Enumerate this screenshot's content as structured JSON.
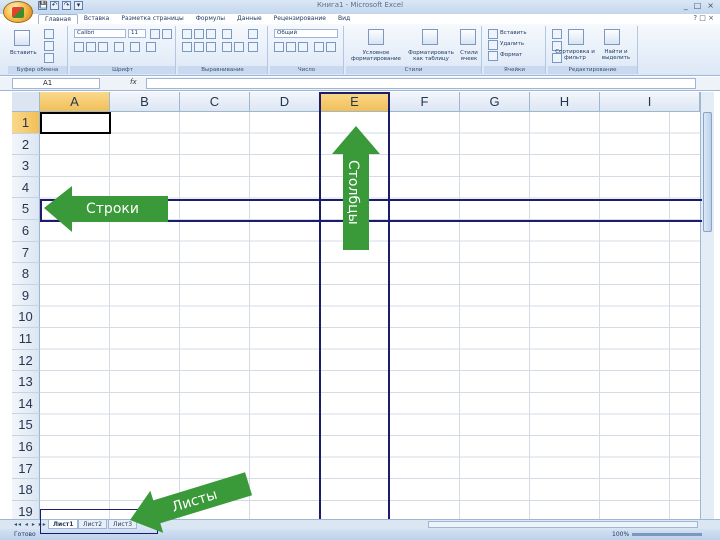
{
  "window": {
    "title": "Книга1 - Microsoft Excel",
    "controls": [
      "_",
      "□",
      "×"
    ]
  },
  "quick_access": [
    "💾",
    "↶",
    "↷",
    "▾"
  ],
  "ribbon": {
    "tabs": [
      {
        "label": "Главная",
        "active": true
      },
      {
        "label": "Вставка",
        "active": false
      },
      {
        "label": "Разметка страницы",
        "active": false
      },
      {
        "label": "Формулы",
        "active": false
      },
      {
        "label": "Данные",
        "active": false
      },
      {
        "label": "Рецензирование",
        "active": false
      },
      {
        "label": "Вид",
        "active": false
      }
    ],
    "groups": {
      "clipboard": {
        "label": "Буфер обмена",
        "paste": "Вставить"
      },
      "font": {
        "label": "Шрифт",
        "font_name": "Calibri",
        "font_size": "11"
      },
      "alignment": {
        "label": "Выравнивание"
      },
      "number": {
        "label": "Число",
        "format": "Общий"
      },
      "styles": {
        "label": "Стили",
        "conditional": "Условное форматирование",
        "as_table": "Форматировать как таблицу",
        "cell_styles": "Стили ячеек"
      },
      "cells": {
        "label": "Ячейки",
        "insert": "Вставить",
        "delete": "Удалить",
        "format": "Формат"
      },
      "editing": {
        "label": "Редактирование",
        "sort": "Сортировка и фильтр",
        "find": "Найти и выделить"
      }
    }
  },
  "formula_bar": {
    "name_box": "A1",
    "fx": "fx",
    "value": ""
  },
  "grid": {
    "columns": [
      "A",
      "B",
      "C",
      "D",
      "E",
      "F",
      "G",
      "H",
      "I"
    ],
    "rows": [
      "1",
      "2",
      "3",
      "4",
      "5",
      "6",
      "7",
      "8",
      "9",
      "10",
      "11",
      "12",
      "13",
      "14",
      "15",
      "16",
      "17",
      "18",
      "19"
    ],
    "active_cell": "A1",
    "highlighted_column": "E",
    "highlighted_row": "5"
  },
  "sheets": [
    {
      "label": "Лист1",
      "active": true
    },
    {
      "label": "Лист2",
      "active": false
    },
    {
      "label": "Лист3",
      "active": false
    }
  ],
  "status": {
    "text": "Готово",
    "zoom": "100%"
  },
  "annotations": {
    "rows_label": "Строки",
    "columns_label": "Столбцы",
    "sheets_label": "Листы",
    "arrow_color": "#3a9a3a",
    "frame_color": "#1b1c6b"
  }
}
